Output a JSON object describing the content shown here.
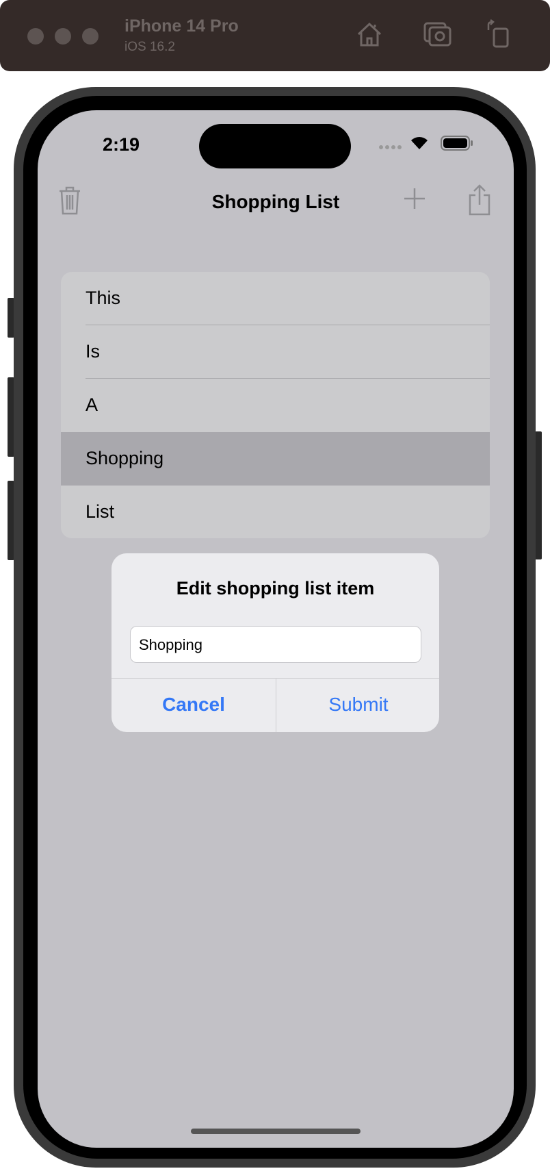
{
  "simulator": {
    "device": "iPhone 14 Pro",
    "os": "iOS 16.2"
  },
  "status": {
    "time": "2:19"
  },
  "nav": {
    "title": "Shopping List"
  },
  "list": {
    "items": [
      "This",
      "Is",
      "A",
      "Shopping",
      "List"
    ],
    "selected_index": 3
  },
  "dialog": {
    "title": "Edit shopping list item",
    "input_value": "Shopping",
    "cancel": "Cancel",
    "submit": "Submit"
  },
  "colors": {
    "accent": "#3478f6",
    "background": "#c2c1c6"
  }
}
